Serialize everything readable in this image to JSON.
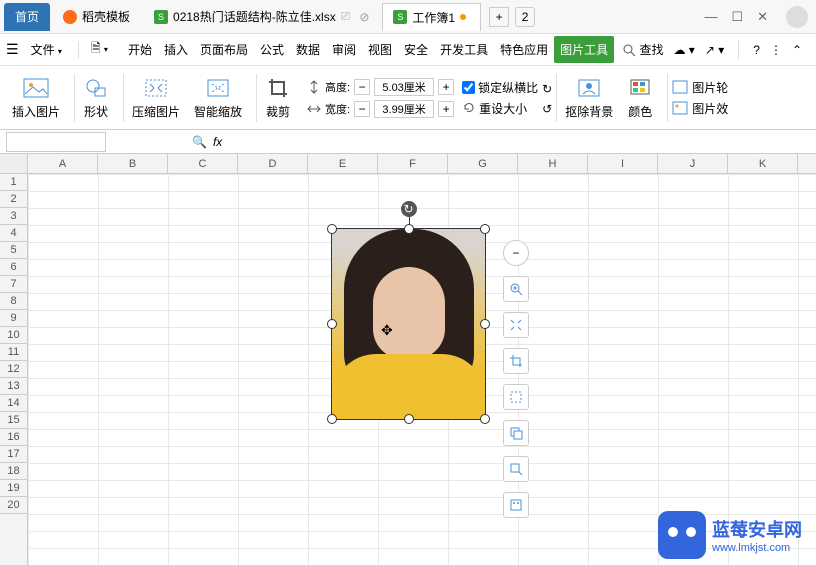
{
  "tabs": {
    "home": "首页",
    "docke": "稻壳模板",
    "file1": "0218热门话题结构-陈立佳.xlsx",
    "file2": "工作簿1",
    "plus": "+",
    "count": "2"
  },
  "menu": {
    "file": "文件",
    "items": [
      "开始",
      "插入",
      "页面布局",
      "公式",
      "数据",
      "审阅",
      "视图",
      "安全",
      "开发工具",
      "特色应用",
      "图片工具"
    ],
    "search": "查找"
  },
  "ribbon": {
    "insert_pic": "插入图片",
    "shape": "形状",
    "compress": "压缩图片",
    "smart_scale": "智能缩放",
    "crop": "裁剪",
    "height_label": "高度:",
    "height_value": "5.03厘米",
    "width_label": "宽度:",
    "width_value": "3.99厘米",
    "lock_ratio": "锁定纵横比",
    "reset_size": "重设大小",
    "remove_bg": "抠除背景",
    "color": "颜色",
    "pic_fx1": "图片轮",
    "pic_fx2": "图片效"
  },
  "cols": [
    "A",
    "B",
    "C",
    "D",
    "E",
    "F",
    "G",
    "H",
    "I",
    "J",
    "K"
  ],
  "rows": [
    "1",
    "2",
    "3",
    "4",
    "5",
    "6",
    "7",
    "8",
    "9",
    "10",
    "11",
    "12",
    "13",
    "14",
    "15",
    "16",
    "17",
    "18",
    "19",
    "20"
  ],
  "watermark": {
    "title": "蓝莓安卓网",
    "url": "www.lmkjst.com"
  }
}
